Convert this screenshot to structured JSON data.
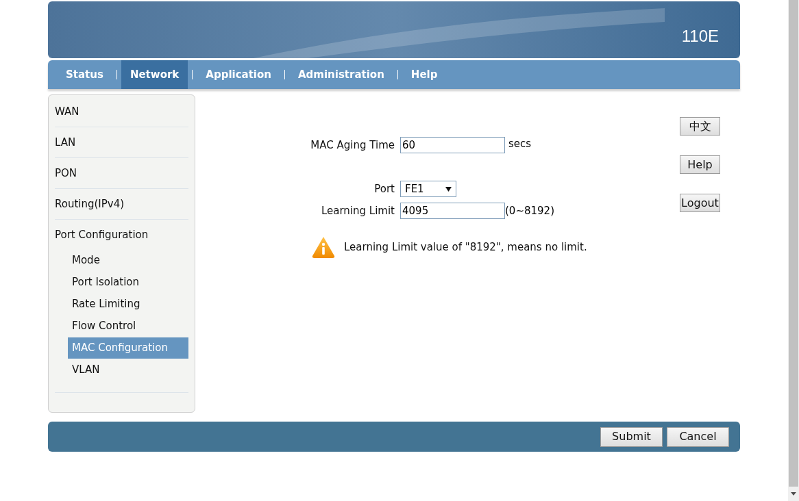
{
  "header": {
    "model": "110E"
  },
  "nav": [
    {
      "label": "Status",
      "selected": false
    },
    {
      "label": "Network",
      "selected": true
    },
    {
      "label": "Application",
      "selected": false
    },
    {
      "label": "Administration",
      "selected": false
    },
    {
      "label": "Help",
      "selected": false
    }
  ],
  "sidebar": {
    "items": [
      {
        "label": "WAN",
        "selected": false
      },
      {
        "label": "LAN",
        "selected": false
      },
      {
        "label": "PON",
        "selected": false
      },
      {
        "label": "Routing(IPv4)",
        "selected": false
      },
      {
        "label": "Port Configuration",
        "selected": false,
        "children": [
          {
            "label": "Mode",
            "selected": false
          },
          {
            "label": "Port Isolation",
            "selected": false
          },
          {
            "label": "Rate Limiting",
            "selected": false
          },
          {
            "label": "Flow Control",
            "selected": false
          },
          {
            "label": "MAC Configuration",
            "selected": true
          },
          {
            "label": "VLAN",
            "selected": false
          }
        ]
      }
    ]
  },
  "form": {
    "aging": {
      "label": "MAC Aging Time",
      "value": "60",
      "unit": "secs"
    },
    "port": {
      "label": "Port",
      "value": "FE1"
    },
    "limit": {
      "label": "Learning Limit",
      "value": "4095",
      "range": "(0~8192)"
    },
    "hint": "Learning Limit value of \"8192\", means no limit."
  },
  "side_buttons": [
    "中文",
    "Help",
    "Logout"
  ],
  "footer_buttons": [
    "Submit",
    "Cancel"
  ]
}
